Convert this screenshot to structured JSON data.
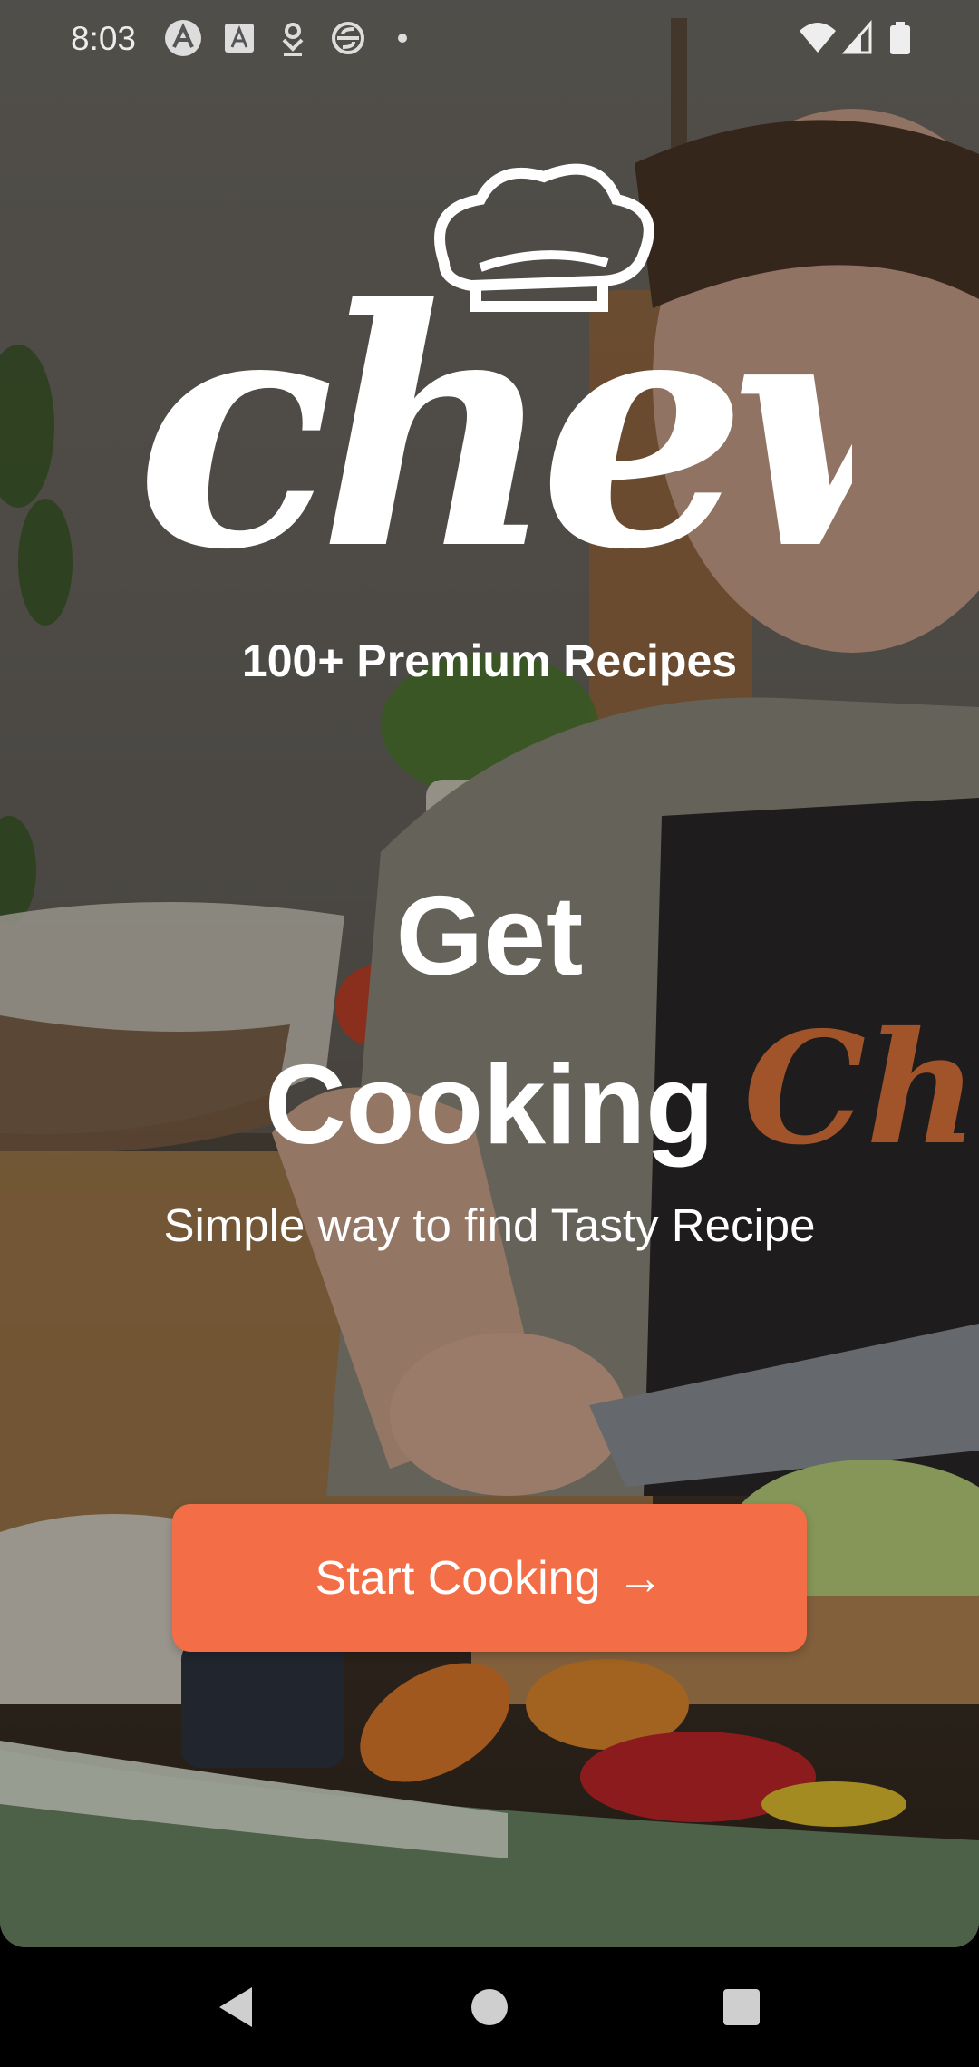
{
  "status_bar": {
    "time": "8:03",
    "left_icons": [
      "app-a-icon",
      "font-a-icon",
      "download-icon",
      "circle-s-icon",
      "dot-icon"
    ],
    "right_icons": [
      "wifi-icon",
      "signal-icon",
      "battery-icon"
    ]
  },
  "logo": {
    "text": "chew",
    "icon": "chef-hat-icon"
  },
  "tagline": "100+ Premium Recipes",
  "hero": {
    "line1": "Get",
    "line2": "Cooking",
    "subtitle": "Simple way to find Tasty Recipe"
  },
  "cta": {
    "label": "Start Cooking",
    "arrow": "→",
    "color": "#f36e47"
  },
  "apron_logo_text": "Chew",
  "nav_bar": {
    "buttons": [
      "back-icon",
      "home-icon",
      "recents-icon"
    ]
  }
}
